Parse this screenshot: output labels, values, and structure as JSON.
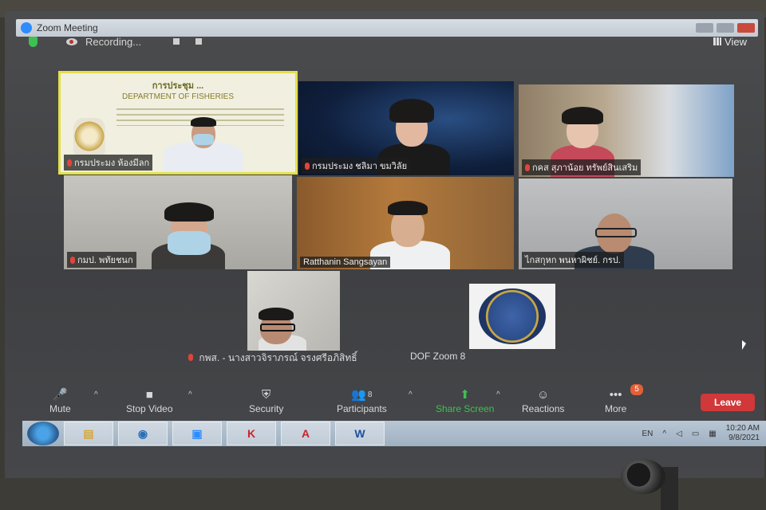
{
  "window": {
    "title": "Zoom Meeting"
  },
  "topbar": {
    "recording_label": "Recording...",
    "view_label": "View"
  },
  "tiles": [
    {
      "id": "t1",
      "name": "กรมประมง ห้องมีลก",
      "muted": true,
      "active": true,
      "slide_title": "การประชุม ...",
      "slide_subtitle": "DEPARTMENT OF FISHERIES"
    },
    {
      "id": "t2",
      "name": "กรมประมง ชลิมา ขมวิลัย",
      "muted": true,
      "active": false
    },
    {
      "id": "t3",
      "name": "กคส สุภาน้อย ทรัพย์สินเสริม",
      "muted": true,
      "active": false
    },
    {
      "id": "t4",
      "name": "กมป. พทัยชนก",
      "muted": true,
      "active": false
    },
    {
      "id": "t5",
      "name": "Ratthanin Sangsayan",
      "muted": false,
      "active": false
    },
    {
      "id": "t6",
      "name": "ไกสกุหก พนหาผิชย์. กรป.",
      "muted": false,
      "active": false
    },
    {
      "id": "t7",
      "name": "กพส. - นางสาวจิราภรณ์ จรงศรีอภิสิทธิ์",
      "muted": true,
      "active": false
    },
    {
      "id": "t8",
      "name": "DOF Zoom 8",
      "muted": false,
      "active": false,
      "logo_text": "Department of Fisheries"
    }
  ],
  "toolbar": {
    "mute": "Mute",
    "stop_video": "Stop Video",
    "security": "Security",
    "participants": "Participants",
    "participants_count": "8",
    "share_screen": "Share Screen",
    "reactions": "Reactions",
    "more": "More",
    "more_badge": "5",
    "leave": "Leave"
  },
  "taskbar": {
    "apps": [
      "folder",
      "browser",
      "zoom",
      "kaspersky",
      "acrobat",
      "word"
    ],
    "language": "EN",
    "time": "10:20 AM",
    "date": "9/8/2021"
  },
  "colors": {
    "active_speaker": "#e4e04a",
    "share_green": "#3ec052",
    "leave_red": "#d0383a",
    "mic_off_red": "#e0443a"
  }
}
